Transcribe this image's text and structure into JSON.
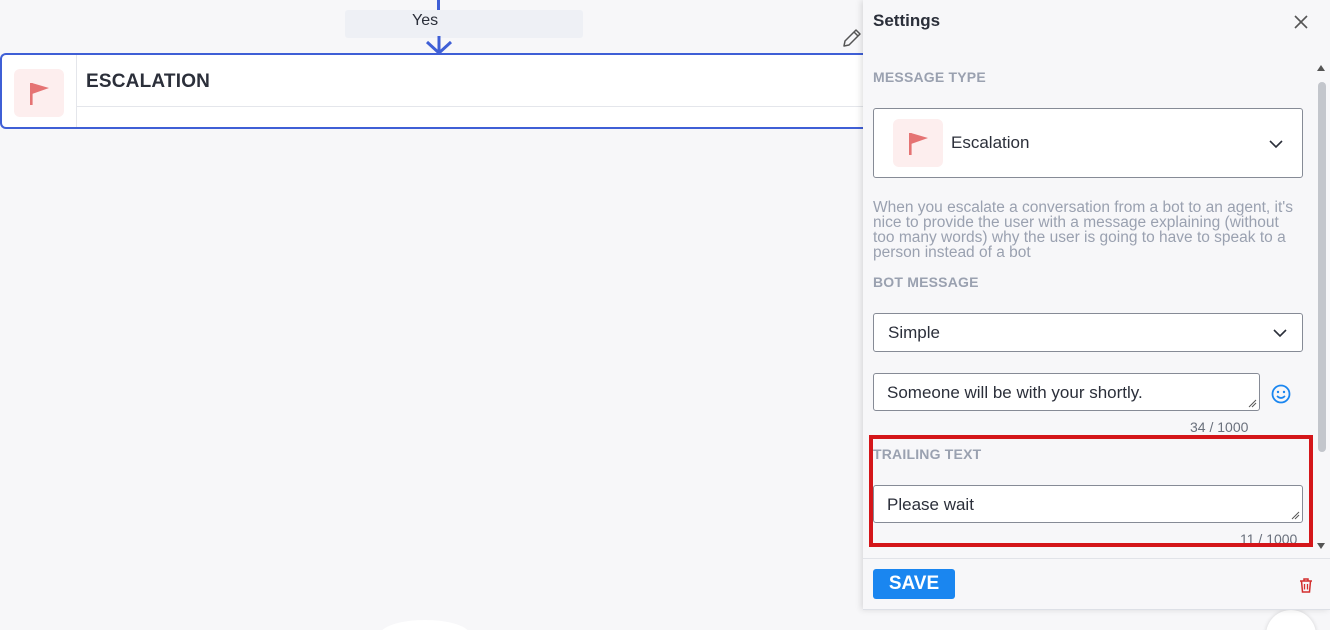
{
  "canvas": {
    "edge_label": "Yes",
    "node": {
      "title": "ESCALATION",
      "icon": "flag-icon"
    }
  },
  "settings": {
    "title": "Settings",
    "message_type": {
      "label": "MESSAGE TYPE",
      "selected": "Escalation",
      "icon": "flag-icon"
    },
    "help_text": "When you escalate a conversation from a bot to an agent, it's nice to provide the user with a message explaining (without too many words) why the user is going to have to speak to a person instead of a bot",
    "bot_message": {
      "label": "BOT MESSAGE",
      "selected": "Simple",
      "text_value": "Someone will be with your shortly.",
      "counter": "34 / 1000"
    },
    "trailing_text": {
      "label": "TRAILING TEXT",
      "value": "Please wait",
      "counter": "11 / 1000"
    },
    "save_label": "SAVE"
  },
  "colors": {
    "accent": "#3f5fd6",
    "save": "#1a86f0",
    "flag": "#e57373",
    "highlight": "#d4161a",
    "delete": "#d32f2f"
  }
}
